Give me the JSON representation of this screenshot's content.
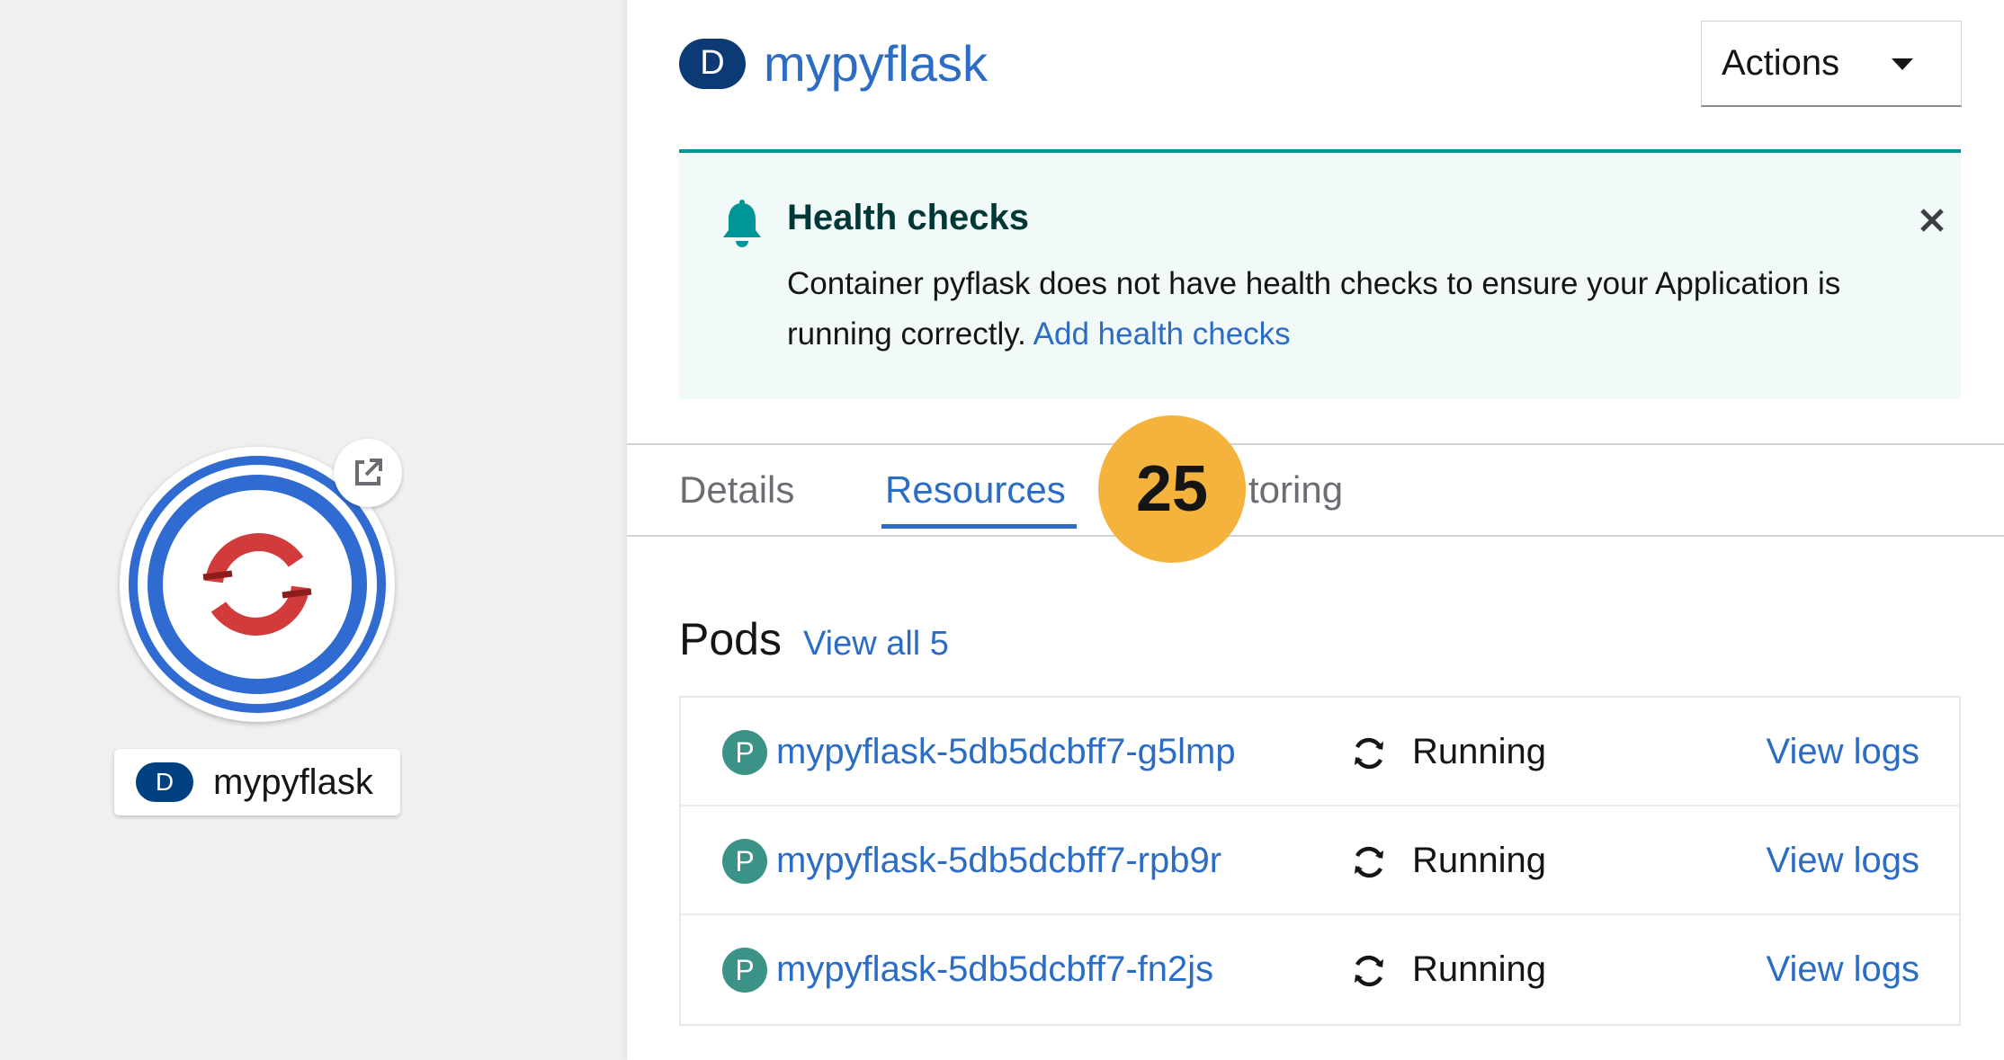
{
  "topology": {
    "node_label": "mypyflask",
    "node_kind_badge": "D"
  },
  "panel": {
    "kind_badge": "D",
    "title": "mypyflask",
    "actions_label": "Actions"
  },
  "alert": {
    "title": "Health checks",
    "body": "Container pyflask does not have health checks to ensure your Application is running correctly.",
    "link": "Add health checks"
  },
  "tabs": [
    {
      "label": "Details"
    },
    {
      "label": "Resources"
    },
    {
      "label": "toring"
    }
  ],
  "step_badge": "25",
  "pods": {
    "heading": "Pods",
    "view_all": "View all 5",
    "items": [
      {
        "badge": "P",
        "name": "mypyflask-5db5dcbff7-g5lmp",
        "status": "Running",
        "logs": "View logs"
      },
      {
        "badge": "P",
        "name": "mypyflask-5db5dcbff7-rpb9r",
        "status": "Running",
        "logs": "View logs"
      },
      {
        "badge": "P",
        "name": "mypyflask-5db5dcbff7-fn2js",
        "status": "Running",
        "logs": "View logs"
      }
    ]
  },
  "colors": {
    "accent": "#2b6cc4",
    "alert_border": "#009596",
    "step_badge": "#f4b33d",
    "pod_badge": "#3b9287"
  }
}
